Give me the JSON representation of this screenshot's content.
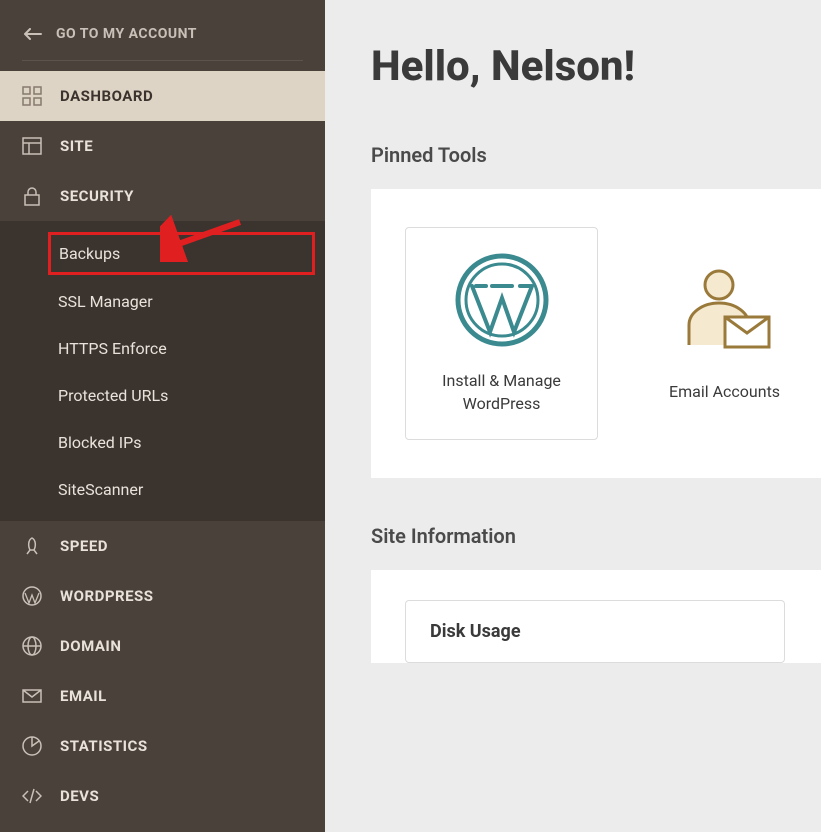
{
  "sidebar": {
    "back_label": "GO TO MY ACCOUNT",
    "items": [
      {
        "label": "DASHBOARD",
        "icon": "dashboard-icon",
        "active": true
      },
      {
        "label": "SITE",
        "icon": "site-icon"
      },
      {
        "label": "SECURITY",
        "icon": "security-icon",
        "expanded": true,
        "submenu": [
          {
            "label": "Backups",
            "highlighted": true
          },
          {
            "label": "SSL Manager"
          },
          {
            "label": "HTTPS Enforce"
          },
          {
            "label": "Protected URLs"
          },
          {
            "label": "Blocked IPs"
          },
          {
            "label": "SiteScanner"
          }
        ]
      },
      {
        "label": "SPEED",
        "icon": "speed-icon"
      },
      {
        "label": "WORDPRESS",
        "icon": "wordpress-icon"
      },
      {
        "label": "DOMAIN",
        "icon": "domain-icon"
      },
      {
        "label": "EMAIL",
        "icon": "email-icon"
      },
      {
        "label": "STATISTICS",
        "icon": "statistics-icon"
      },
      {
        "label": "DEVS",
        "icon": "devs-icon"
      }
    ]
  },
  "main": {
    "greeting": "Hello, Nelson!",
    "pinned_tools_title": "Pinned Tools",
    "tools": [
      {
        "label": "Install & Manage WordPress",
        "icon": "wordpress-tool"
      },
      {
        "label": "Email Accounts",
        "icon": "email-accounts-tool"
      }
    ],
    "site_info_title": "Site Information",
    "disk_usage_title": "Disk Usage"
  },
  "annotation": {
    "arrow_color": "#e02020",
    "highlight_color": "#e02020",
    "target": "Backups"
  }
}
